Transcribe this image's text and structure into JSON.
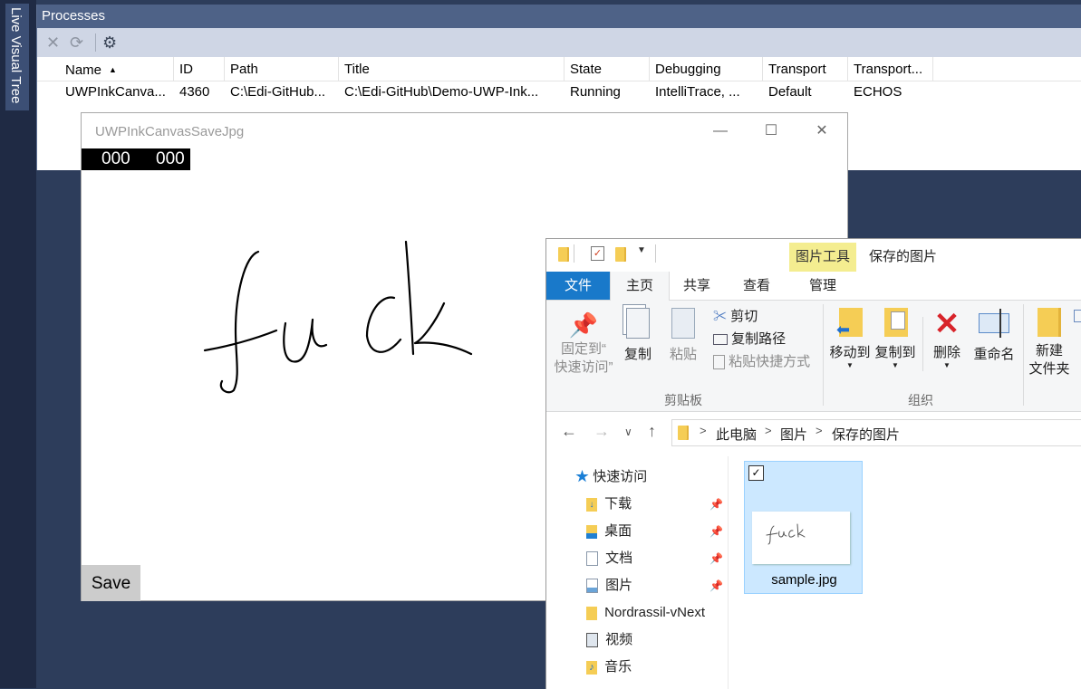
{
  "side_tab": {
    "label": "Live Visual Tree"
  },
  "processes": {
    "title": "Processes",
    "toolbar": {
      "detach_icon": "close-icon",
      "disabled_icon": "detach-process-icon",
      "settings_icon": "gears-icon"
    },
    "columns": [
      "Name",
      "ID",
      "Path",
      "Title",
      "State",
      "Debugging",
      "Transport",
      "Transport..."
    ],
    "rows": [
      [
        "UWPInkCanva...",
        "4360",
        "C:\\Edi-GitHub...",
        "C:\\Edi-GitHub\\Demo-UWP-Ink...",
        "Running",
        "IntelliTrace, ...",
        "Default",
        "ECHOS"
      ]
    ]
  },
  "uwp_window": {
    "title": "UWPInkCanvasSaveJpg",
    "counter": [
      "000",
      "000"
    ],
    "save_label": "Save",
    "ink_word": "fuck"
  },
  "explorer": {
    "folder_title": "保存的图片",
    "context_tab": "图片工具",
    "tabs": {
      "file": "文件",
      "home": "主页",
      "share": "共享",
      "view": "查看",
      "manage": "管理"
    },
    "ribbon": {
      "pin_line1": "固定到“",
      "pin_line2": "快速访问”",
      "copy": "复制",
      "paste": "粘贴",
      "cut": "剪切",
      "copy_path": "复制路径",
      "paste_shortcut": "粘贴快捷方式",
      "clipboard_group": "剪贴板",
      "move_to": "移动到",
      "copy_to": "复制到",
      "delete": "删除",
      "rename": "重命名",
      "organize_group": "组织",
      "new_folder_line1": "新建",
      "new_folder_line2": "文件夹"
    },
    "breadcrumb": [
      "此电脑",
      "图片",
      "保存的图片"
    ],
    "nav": {
      "quick_access": "快速访问",
      "downloads": "下载",
      "desktop": "桌面",
      "documents": "文档",
      "pictures": "图片",
      "nordrassil": "Nordrassil-vNext",
      "videos": "视频",
      "music": "音乐"
    },
    "file": {
      "name": "sample.jpg",
      "thumb_text": "fuck"
    }
  }
}
